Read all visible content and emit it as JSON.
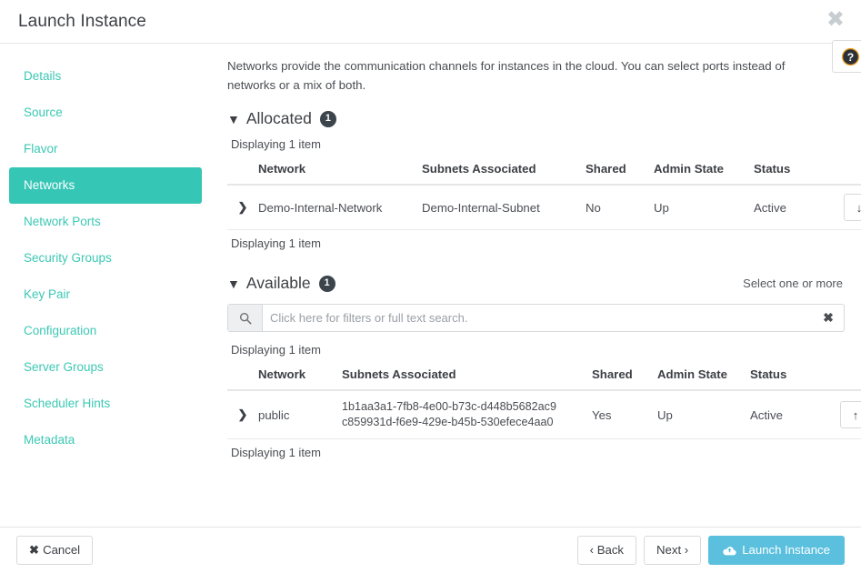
{
  "window": {
    "title": "Launch Instance",
    "close_label": "✖",
    "help_icon": "question-circle-icon"
  },
  "sidebar": {
    "items": [
      {
        "label": "Details",
        "active": false
      },
      {
        "label": "Source",
        "active": false
      },
      {
        "label": "Flavor",
        "active": false
      },
      {
        "label": "Networks",
        "active": true
      },
      {
        "label": "Network Ports",
        "active": false
      },
      {
        "label": "Security Groups",
        "active": false
      },
      {
        "label": "Key Pair",
        "active": false
      },
      {
        "label": "Configuration",
        "active": false
      },
      {
        "label": "Server Groups",
        "active": false
      },
      {
        "label": "Scheduler Hints",
        "active": false
      },
      {
        "label": "Metadata",
        "active": false
      }
    ]
  },
  "main": {
    "description": "Networks provide the communication channels for instances in the cloud. You can select ports instead of networks or a mix of both.",
    "allocated": {
      "caret": "⌄",
      "title": "Allocated",
      "count": "1",
      "displaying_top": "Displaying 1 item",
      "displaying_bottom": "Displaying 1 item",
      "columns": [
        "Network",
        "Subnets Associated",
        "Shared",
        "Admin State",
        "Status"
      ],
      "rows": [
        {
          "expand_icon": "❯",
          "network": "Demo-Internal-Network",
          "subnets": [
            "Demo-Internal-Subnet"
          ],
          "shared": "No",
          "admin_state": "Up",
          "status": "Active",
          "action_icon": "↓",
          "action_name": "deallocate-network-button"
        }
      ]
    },
    "available": {
      "caret": "⌄",
      "title": "Available",
      "count": "1",
      "select_hint": "Select one or more",
      "search_placeholder": "Click here for filters or full text search.",
      "search_value": "",
      "search_icon": "search-icon",
      "clear_label": "✖",
      "displaying_top": "Displaying 1 item",
      "displaying_bottom": "Displaying 1 item",
      "columns": [
        "Network",
        "Subnets Associated",
        "Shared",
        "Admin State",
        "Status"
      ],
      "rows": [
        {
          "expand_icon": "❯",
          "network": "public",
          "subnets": [
            "1b1aa3a1-7fb8-4e00-b73c-d448b5682ac9",
            "c859931d-f6e9-429e-b45b-530efece4aa0"
          ],
          "shared": "Yes",
          "admin_state": "Up",
          "status": "Active",
          "action_icon": "↑",
          "action_name": "allocate-network-button"
        }
      ]
    }
  },
  "footer": {
    "cancel": "Cancel",
    "cancel_icon": "✖",
    "back": "‹ Back",
    "next": "Next ›",
    "launch": "Launch Instance",
    "launch_icon": "cloud-upload-icon"
  },
  "colors": {
    "accent_teal": "#36c6b6",
    "primary_blue": "#5bc0de",
    "badge_dark": "#3c444c"
  }
}
